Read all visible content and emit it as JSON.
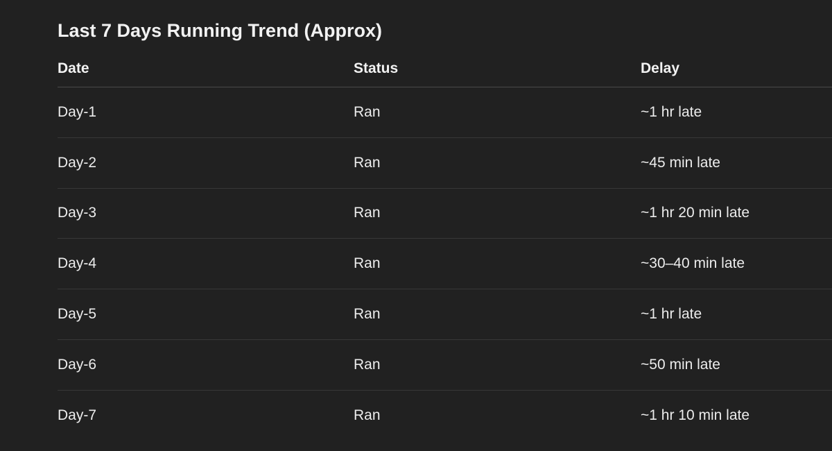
{
  "title": "Last 7 Days Running Trend (Approx)",
  "table": {
    "headers": [
      "Date",
      "Status",
      "Delay"
    ],
    "rows": [
      [
        "Day-1",
        "Ran",
        "~1 hr late"
      ],
      [
        "Day-2",
        "Ran",
        "~45 min late"
      ],
      [
        "Day-3",
        "Ran",
        "~1 hr 20 min late"
      ],
      [
        "Day-4",
        "Ran",
        "~30–40 min late"
      ],
      [
        "Day-5",
        "Ran",
        "~1 hr late"
      ],
      [
        "Day-6",
        "Ran",
        "~50 min late"
      ],
      [
        "Day-7",
        "Ran",
        "~1 hr 10 min late"
      ]
    ]
  }
}
